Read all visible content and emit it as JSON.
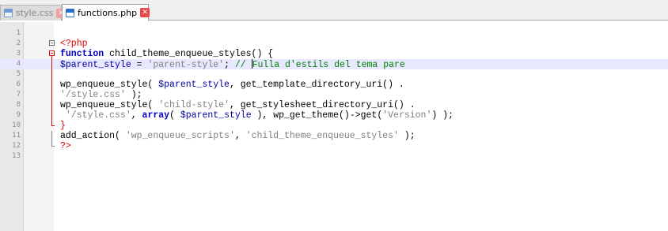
{
  "tabs": [
    {
      "label": "style.css",
      "active": false,
      "icon": "file-icon",
      "close_glyph": "✕"
    },
    {
      "label": "functions.php",
      "active": true,
      "icon": "file-icon",
      "close_glyph": "✕"
    }
  ],
  "editor": {
    "line_numbers": [
      "1",
      "2",
      "3",
      "4",
      "5",
      "6",
      "7",
      "8",
      "9",
      "10",
      "11",
      "12",
      "13"
    ],
    "current_line": 4,
    "lines": [
      [],
      [
        {
          "t": "<?php",
          "c": "php"
        }
      ],
      [
        {
          "t": "function",
          "c": "kw"
        },
        {
          "t": " child_theme_enqueue_styles() {",
          "c": "fn"
        }
      ],
      [
        {
          "t": "$parent_style",
          "c": "var"
        },
        {
          "t": " = ",
          "c": "op"
        },
        {
          "t": "'parent-style'",
          "c": "str"
        },
        {
          "t": "; ",
          "c": "op"
        },
        {
          "t": "// ",
          "c": "cmt"
        },
        {
          "t": "Fulla d'estils del tema pare",
          "c": "cmt"
        }
      ],
      [],
      [
        {
          "t": "wp_enqueue_style( ",
          "c": "fn"
        },
        {
          "t": "$parent_style",
          "c": "var"
        },
        {
          "t": ", get_template_directory_uri() .",
          "c": "fn"
        }
      ],
      [
        {
          "t": "'/style.css'",
          "c": "str"
        },
        {
          "t": " );",
          "c": "op"
        }
      ],
      [
        {
          "t": "wp_enqueue_style( ",
          "c": "fn"
        },
        {
          "t": "'child-style'",
          "c": "str"
        },
        {
          "t": ", get_stylesheet_directory_uri() .",
          "c": "fn"
        }
      ],
      [
        {
          "t": " ",
          "c": "op"
        },
        {
          "t": "'/style.css'",
          "c": "str"
        },
        {
          "t": ", ",
          "c": "op"
        },
        {
          "t": "array",
          "c": "kw"
        },
        {
          "t": "( ",
          "c": "op"
        },
        {
          "t": "$parent_style",
          "c": "var"
        },
        {
          "t": " ), wp_get_theme()->get(",
          "c": "fn"
        },
        {
          "t": "'Version'",
          "c": "str"
        },
        {
          "t": ") );",
          "c": "op"
        }
      ],
      [
        {
          "t": "}",
          "c": "php"
        }
      ],
      [
        {
          "t": "add_action( ",
          "c": "fn"
        },
        {
          "t": "'wp_enqueue_scripts'",
          "c": "str"
        },
        {
          "t": ", ",
          "c": "op"
        },
        {
          "t": "'child_theme_enqueue_styles'",
          "c": "str"
        },
        {
          "t": " );",
          "c": "op"
        }
      ],
      [
        {
          "t": "?>",
          "c": "php"
        }
      ],
      []
    ]
  },
  "colors": {
    "keyword": "#0000c0",
    "php_tag": "#e00000",
    "variable": "#0000a0",
    "string": "#808080",
    "comment": "#008000",
    "current_line_bg": "#e8e8ff",
    "close_button": "#e84a4a"
  }
}
